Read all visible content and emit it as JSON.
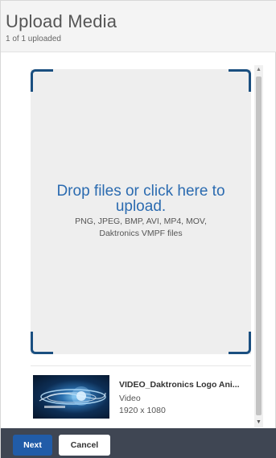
{
  "header": {
    "title": "Upload Media",
    "subtitle": "1 of 1 uploaded"
  },
  "dropzone": {
    "primary_text": "Drop files or click here to upload.",
    "formats_text": "PNG, JPEG, BMP, AVI, MP4, MOV, Daktronics VMPF files"
  },
  "files": [
    {
      "name": "VIDEO_Daktronics Logo Ani...",
      "type": "Video",
      "resolution": "1920 x 1080",
      "thumbnail_icon": "video-thumbnail-daktronics-logo"
    }
  ],
  "footer": {
    "next_label": "Next",
    "cancel_label": "Cancel"
  },
  "colors": {
    "accent": "#2b6bb0",
    "corner": "#1a4f80",
    "footer_bg": "#3f4653",
    "primary_button": "#215ca8"
  }
}
